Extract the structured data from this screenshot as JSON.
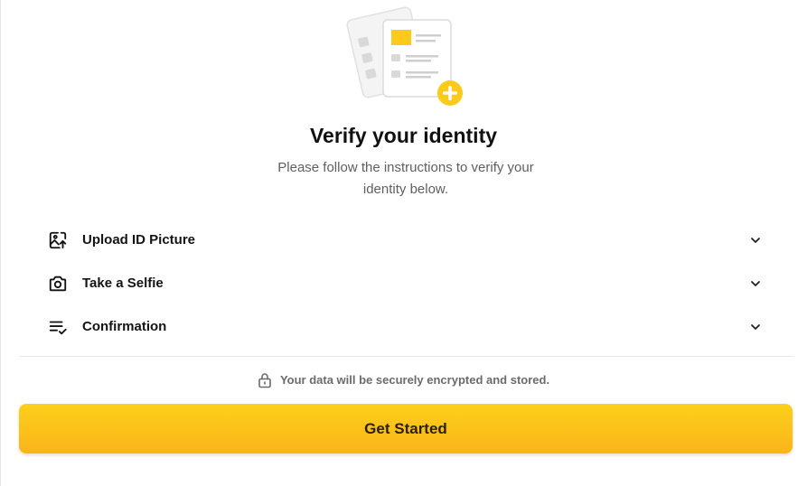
{
  "title": "Verify your identity",
  "subtitle": "Please follow the instructions to verify your identity below.",
  "steps": [
    {
      "label": "Upload ID Picture",
      "icon": "image-upload-icon"
    },
    {
      "label": "Take a Selfie",
      "icon": "camera-icon"
    },
    {
      "label": "Confirmation",
      "icon": "checklist-icon"
    }
  ],
  "security_note": "Your data will be securely encrypted and stored.",
  "cta_label": "Get Started",
  "colors": {
    "accent_top": "#fcd01b",
    "accent_bottom": "#fab41a",
    "text_primary": "#111111",
    "text_secondary": "#5f5f5f"
  }
}
